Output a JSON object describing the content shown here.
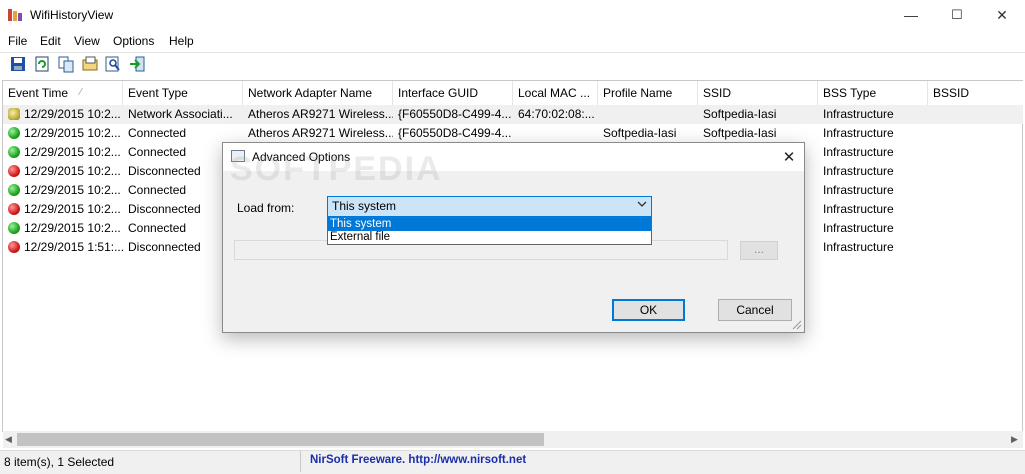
{
  "window": {
    "title": "WifiHistoryView",
    "minimize": "—",
    "maximize": "☐",
    "close": "✕"
  },
  "menu": [
    "File",
    "Edit",
    "View",
    "Options",
    "Help"
  ],
  "toolbar": [
    "save-icon",
    "refresh-icon",
    "copy-icon",
    "properties-icon",
    "find-icon",
    "exit-icon"
  ],
  "columns": [
    "Event Time",
    "Event Type",
    "Network Adapter Name",
    "Interface GUID",
    "Local MAC ...",
    "Profile Name",
    "SSID",
    "BSS Type",
    "BSSID"
  ],
  "rows": [
    {
      "status": "network",
      "time": "12/29/2015 10:2...",
      "type": "Network Associati...",
      "adapter": "Atheros AR9271 Wireless...",
      "guid": "{F60550D8-C499-4...",
      "mac": "64:70:02:08:...",
      "profile": "",
      "ssid": "Softpedia-Iasi",
      "bss": "Infrastructure",
      "bssid": ""
    },
    {
      "status": "green",
      "time": "12/29/2015 10:2...",
      "type": "Connected",
      "adapter": "Atheros AR9271 Wireless...",
      "guid": "{F60550D8-C499-4...",
      "mac": "",
      "profile": "Softpedia-Iasi",
      "ssid": "Softpedia-Iasi",
      "bss": "Infrastructure",
      "bssid": ""
    },
    {
      "status": "green",
      "time": "12/29/2015 10:2...",
      "type": "Connected",
      "adapter": "",
      "guid": "",
      "mac": "",
      "profile": "",
      "ssid": "",
      "bss": "Infrastructure",
      "bssid": ""
    },
    {
      "status": "red",
      "time": "12/29/2015 10:2...",
      "type": "Disconnected",
      "adapter": "",
      "guid": "",
      "mac": "",
      "profile": "",
      "ssid": "",
      "bss": "Infrastructure",
      "bssid": ""
    },
    {
      "status": "green",
      "time": "12/29/2015 10:2...",
      "type": "Connected",
      "adapter": "",
      "guid": "",
      "mac": "",
      "profile": "",
      "ssid": "",
      "bss": "Infrastructure",
      "bssid": ""
    },
    {
      "status": "red",
      "time": "12/29/2015 10:2...",
      "type": "Disconnected",
      "adapter": "",
      "guid": "",
      "mac": "",
      "profile": "",
      "ssid": "",
      "bss": "Infrastructure",
      "bssid": ""
    },
    {
      "status": "green",
      "time": "12/29/2015 10:2...",
      "type": "Connected",
      "adapter": "",
      "guid": "",
      "mac": "",
      "profile": "",
      "ssid": "",
      "bss": "Infrastructure",
      "bssid": ""
    },
    {
      "status": "red",
      "time": "12/29/2015 1:51:...",
      "type": "Disconnected",
      "adapter": "",
      "guid": "",
      "mac": "",
      "profile": "",
      "ssid": "",
      "bss": "Infrastructure",
      "bssid": ""
    }
  ],
  "status": {
    "items": "8 item(s), 1 Selected",
    "link": "NirSoft Freeware.  http://www.nirsoft.net"
  },
  "dialog": {
    "title": "Advanced Options",
    "close": "✕",
    "load_label": "Load from:",
    "combo_value": "This system",
    "options": [
      "This system",
      "External file"
    ],
    "browse": "...",
    "ok": "OK",
    "cancel": "Cancel"
  },
  "watermark": "SOFTPEDIA",
  "colors": {
    "accent": "#0078d7",
    "link": "#1a2ea8",
    "selected_row": "#f0f0f0"
  }
}
